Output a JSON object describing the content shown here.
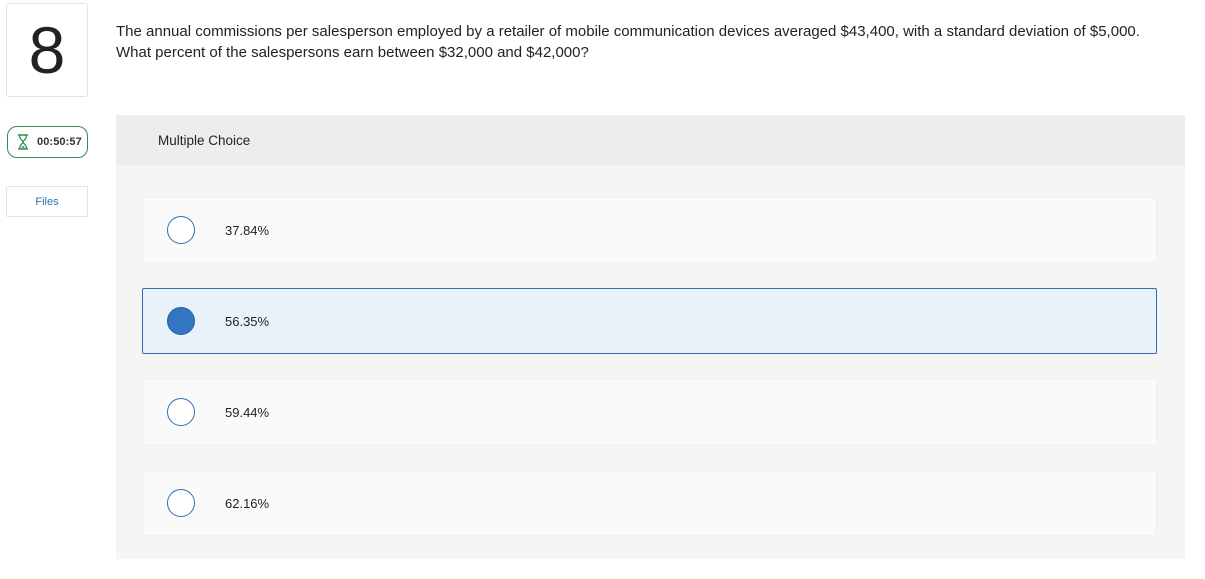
{
  "question_number": "8",
  "timer": {
    "time": "00:50:57",
    "icon": "hourglass-icon",
    "color": "#2f8f4e"
  },
  "files_button": {
    "label": "Files"
  },
  "question_text": "The annual commissions per salesperson employed by a retailer of mobile communication devices averaged $43,400, with a standard deviation of $5,000. What percent of the salespersons earn between $32,000 and $42,000?",
  "multiple_choice": {
    "title": "Multiple Choice",
    "selected_index": 1,
    "options": [
      {
        "label": "37.84%"
      },
      {
        "label": "56.35%"
      },
      {
        "label": "59.44%"
      },
      {
        "label": "62.16%"
      }
    ]
  },
  "colors": {
    "accent": "#2f6fb5",
    "selected_bg": "#e8f2fb",
    "panel_bg": "#f5f5f5"
  }
}
